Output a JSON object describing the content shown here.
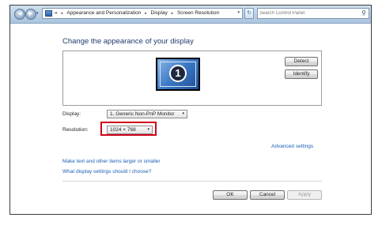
{
  "address_bar": {
    "back_glyph": "◀",
    "forward_glyph": "▶",
    "breadcrumbs": [
      "Appearance and Personalization",
      "Display",
      "Screen Resolution"
    ],
    "overflow_glyph": "«",
    "separator_glyph": "▸",
    "dropdown_glyph": "▾",
    "refresh_glyph": "↻",
    "search_placeholder": "Search Control Panel",
    "search_glyph": "⚲"
  },
  "main": {
    "title": "Change the appearance of your display",
    "monitor_number": "1",
    "detect_label": "Detect",
    "identify_label": "Identify",
    "display_label": "Display:",
    "display_value": "1. Generic Non-PnP Monitor",
    "resolution_label": "Resolution:",
    "resolution_value": "1024 × 768",
    "advanced_link": "Advanced settings",
    "link_larger": "Make text and other items larger or smaller",
    "link_which": "What display settings should I choose?"
  },
  "footer": {
    "ok_label": "OK",
    "cancel_label": "Cancel",
    "apply_label": "Apply"
  },
  "colors": {
    "title": "#1e3a6e",
    "link": "#1a5fb4",
    "highlight_border": "#d0021b"
  }
}
